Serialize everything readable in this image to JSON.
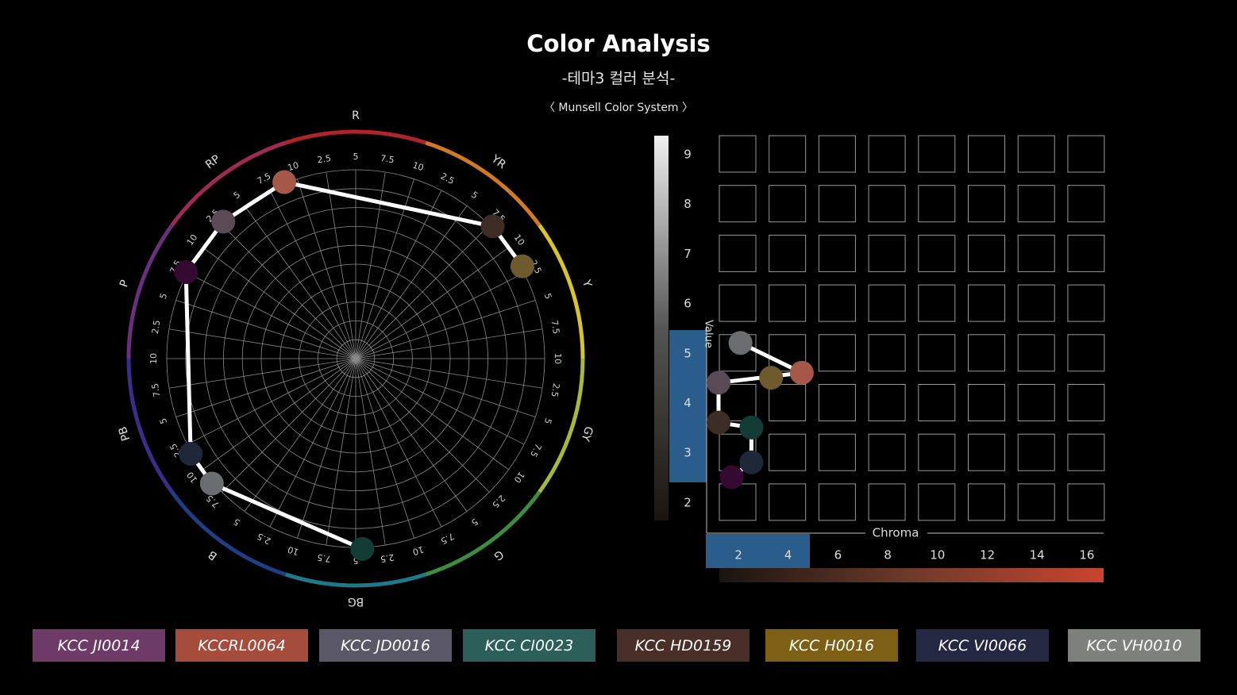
{
  "title": "Color Analysis",
  "subtitle": "-테마3 컬러 분석-",
  "system_label": "〈 Munsell Color System 〉",
  "hue_wheel": {
    "hue_labels": [
      "R",
      "YR",
      "Y",
      "GY",
      "G",
      "BG",
      "B",
      "PB",
      "P",
      "RP"
    ],
    "step_labels": [
      "2.5",
      "5",
      "7.5",
      "10"
    ],
    "ring_colors": [
      "#b0242a",
      "#d17a26",
      "#d8c42a",
      "#a6b93a",
      "#3c8e3e",
      "#1d7a8a",
      "#1d3f86",
      "#3a2e8a",
      "#6a2f7e",
      "#a02a55"
    ],
    "points": [
      {
        "id": "KCCRL0064",
        "hue_angle": -22,
        "color": "#a65848"
      },
      {
        "id": "KCC HD0159",
        "hue_angle": 46,
        "color": "#3e2c26"
      },
      {
        "id": "KCC H0016",
        "hue_angle": 61,
        "color": "#6e5a2c"
      },
      {
        "id": "KCC CI0023",
        "hue_angle": 178,
        "color": "#143c36"
      },
      {
        "id": "KCC VH0010",
        "hue_angle": 229,
        "color": "#6a6e70"
      },
      {
        "id": "KCC VI0066",
        "hue_angle": 240,
        "color": "#1e2838"
      },
      {
        "id": "KCC ?",
        "hue_angle": -63,
        "color": "#340a32"
      },
      {
        "id": "KCC JD0016",
        "hue_angle": -44,
        "color": "#5a4a56"
      }
    ]
  },
  "value_chroma": {
    "axis_value_label": "Value",
    "axis_chroma_label": "Chroma",
    "value_ticks": [
      "9",
      "8",
      "7",
      "6",
      "5",
      "4",
      "3",
      "2"
    ],
    "chroma_ticks": [
      "2",
      "4",
      "6",
      "8",
      "10",
      "12",
      "14",
      "16"
    ],
    "highlight_value": [
      3,
      5
    ],
    "highlight_chroma": [
      2,
      4
    ],
    "points": [
      {
        "chroma": 1.5,
        "value": 5.2,
        "color": "#6a6e70"
      },
      {
        "chroma": 4.3,
        "value": 4.6,
        "color": "#a65848"
      },
      {
        "chroma": 2.9,
        "value": 4.5,
        "color": "#6e5a2c"
      },
      {
        "chroma": 0.5,
        "value": 4.4,
        "color": "#5a4a56"
      },
      {
        "chroma": 0.5,
        "value": 3.6,
        "color": "#3e2c26"
      },
      {
        "chroma": 2.0,
        "value": 3.5,
        "color": "#143c36"
      },
      {
        "chroma": 2.0,
        "value": 2.8,
        "color": "#1e2838"
      },
      {
        "chroma": 1.1,
        "value": 2.5,
        "color": "#340a32"
      }
    ]
  },
  "swatches": [
    {
      "label": "KCC JI0014",
      "color": "#6e3b68"
    },
    {
      "label": "KCCRL0064",
      "color": "#a64c3c"
    },
    {
      "label": "KCC JD0016",
      "color": "#5a5866"
    },
    {
      "label": "KCC CI0023",
      "color": "#2c5e5a"
    },
    {
      "label": "KCC HD0159",
      "color": "#4a2f28"
    },
    {
      "label": "KCC H0016",
      "color": "#7e5f16"
    },
    {
      "label": "KCC VI0066",
      "color": "#242842"
    },
    {
      "label": "KCC VH0010",
      "color": "#7e817b"
    }
  ]
}
